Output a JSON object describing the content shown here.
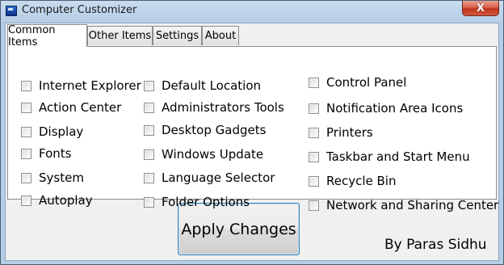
{
  "window": {
    "title": "Computer Customizer",
    "close_symbol": "X"
  },
  "tabs": [
    {
      "label": "Common Items",
      "active": true
    },
    {
      "label": "Other Items",
      "active": false
    },
    {
      "label": "Settings",
      "active": false
    },
    {
      "label": "About",
      "active": false
    }
  ],
  "checkboxes": {
    "column1": [
      {
        "label": "Internet Explorer",
        "checked": false
      },
      {
        "label": "Action Center",
        "checked": false
      },
      {
        "label": "Display",
        "checked": false
      },
      {
        "label": "Fonts",
        "checked": false
      },
      {
        "label": "System",
        "checked": false
      },
      {
        "label": "Autoplay",
        "checked": false
      }
    ],
    "column2": [
      {
        "label": "Default Location",
        "checked": false
      },
      {
        "label": "Administrators Tools",
        "checked": false
      },
      {
        "label": "Desktop Gadgets",
        "checked": false
      },
      {
        "label": "Windows Update",
        "checked": false
      },
      {
        "label": "Language Selector",
        "checked": false
      },
      {
        "label": "Folder Options",
        "checked": false
      }
    ],
    "column3": [
      {
        "label": "Control Panel",
        "checked": false
      },
      {
        "label": "Notification Area Icons",
        "checked": false
      },
      {
        "label": "Printers",
        "checked": false
      },
      {
        "label": "Taskbar and Start Menu",
        "checked": false
      },
      {
        "label": "Recycle Bin",
        "checked": false
      },
      {
        "label": "Network and Sharing Center",
        "checked": false
      }
    ]
  },
  "apply_button": {
    "label": "Apply Changes"
  },
  "credit": "By Paras Sidhu",
  "colors": {
    "title_bar": "#b6cde6",
    "close_button": "#c2331d",
    "button_border": "#3c7fb1",
    "panel_background": "#ffffff"
  },
  "icons": {
    "app": "window-app-icon",
    "close": "close-icon"
  }
}
